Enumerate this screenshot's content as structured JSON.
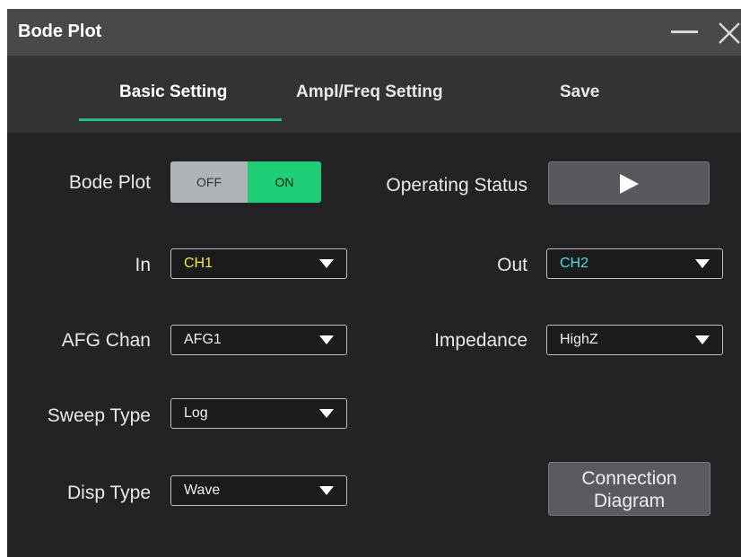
{
  "window": {
    "title": "Bode Plot"
  },
  "tabs": [
    {
      "label": "Basic Setting",
      "active": true
    },
    {
      "label": "Ampl/Freq Setting",
      "active": false
    },
    {
      "label": "Save",
      "active": false
    }
  ],
  "fields": {
    "bode_plot": {
      "label": "Bode Plot",
      "off_label": "OFF",
      "on_label": "ON",
      "state": "ON"
    },
    "operating_status": {
      "label": "Operating Status",
      "icon": "play-icon"
    },
    "in": {
      "label": "In",
      "value": "CH1",
      "color": "#f5e84a"
    },
    "out": {
      "label": "Out",
      "value": "CH2",
      "color": "#3fe3f0"
    },
    "afg_chan": {
      "label": "AFG Chan",
      "value": "AFG1"
    },
    "impedance": {
      "label": "Impedance",
      "value": "HighZ"
    },
    "sweep_type": {
      "label": "Sweep Type",
      "value": "Log"
    },
    "disp_type": {
      "label": "Disp Type",
      "value": "Wave"
    }
  },
  "connection_button": {
    "line1": "Connection",
    "line2": "Diagram"
  },
  "colors": {
    "accent": "#1ec07a",
    "toggle_on": "#1ecf78"
  }
}
